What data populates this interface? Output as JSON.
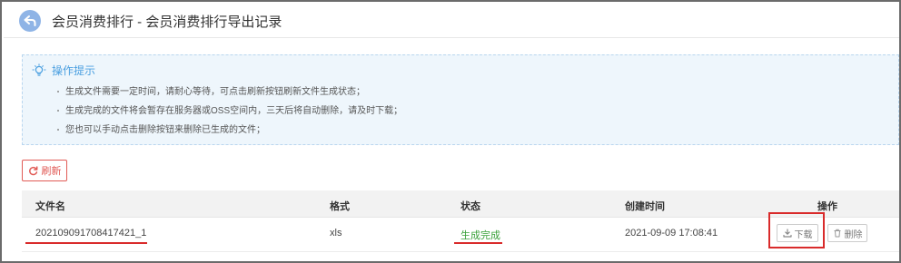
{
  "header": {
    "title": "会员消费排行 - 会员消费排行导出记录"
  },
  "tips": {
    "title": "操作提示",
    "items": [
      "生成文件需要一定时间，请耐心等待，可点击刷新按钮刷新文件生成状态；",
      "生成完成的文件将会暂存在服务器或OSS空间内，三天后将自动删除，请及时下载；",
      "您也可以手动点击删除按钮来删除已生成的文件；"
    ]
  },
  "toolbar": {
    "refresh_label": "刷新"
  },
  "table": {
    "columns": [
      "文件名",
      "格式",
      "状态",
      "创建时间",
      "操作"
    ],
    "rows": [
      {
        "filename": "202109091708417421_1",
        "format": "xls",
        "status": "生成完成",
        "created": "2021-09-09 17:08:41",
        "download_label": "下载",
        "delete_label": "删除"
      }
    ]
  },
  "colors": {
    "accent": "#4a9fe0",
    "danger": "#e15b56",
    "success": "#3aa13a",
    "annotation": "#d92b2b"
  }
}
